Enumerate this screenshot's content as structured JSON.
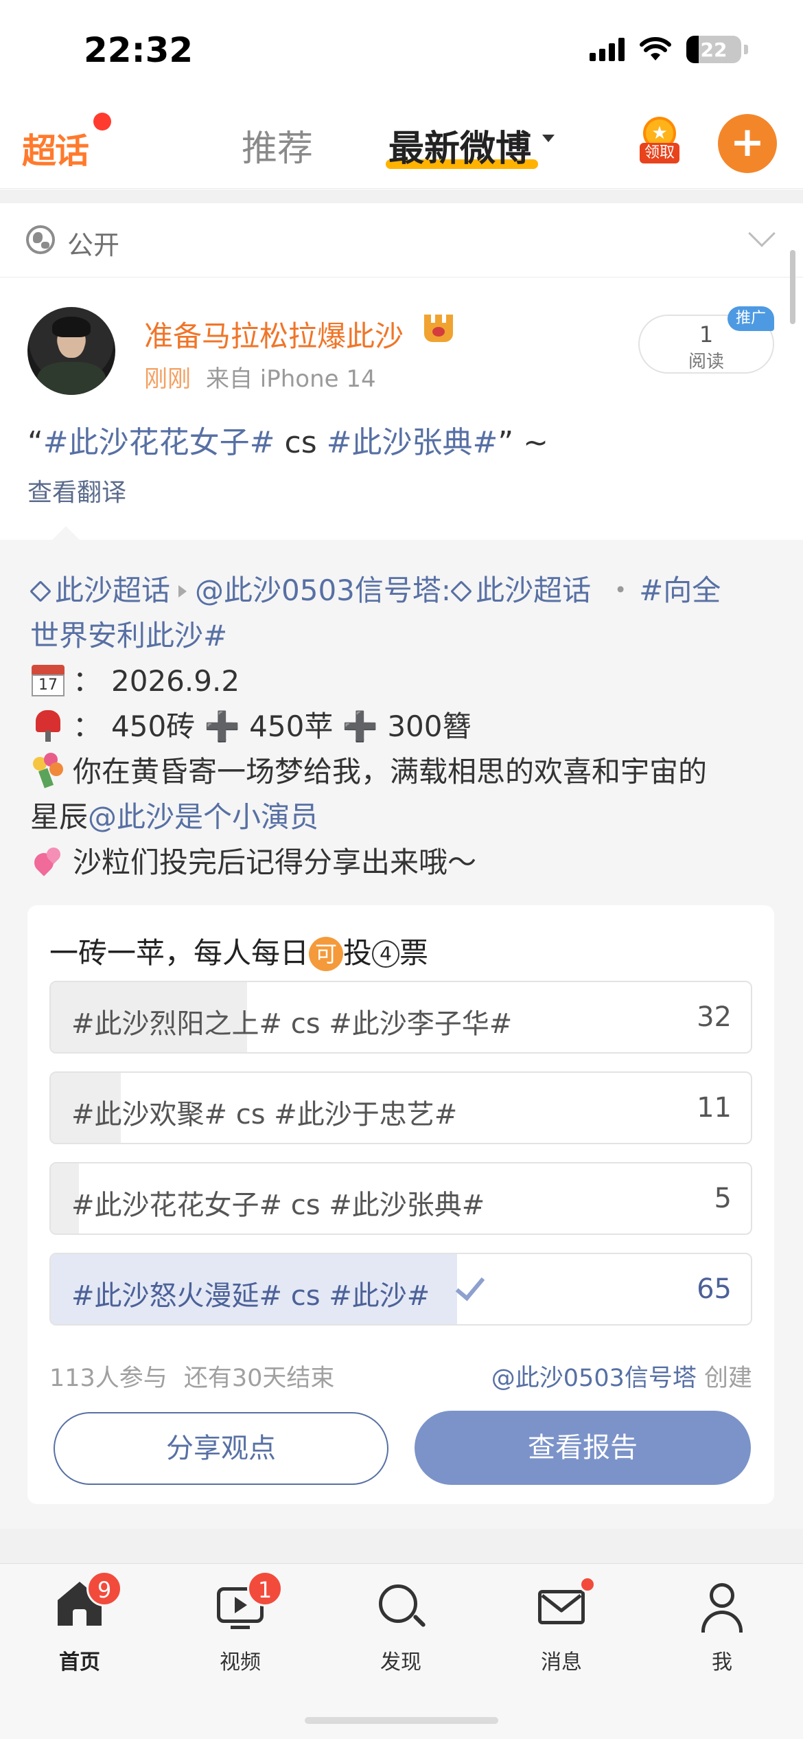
{
  "status_bar": {
    "time": "22:32",
    "battery": "22",
    "battery_level": 0.22
  },
  "header": {
    "logo": "超话",
    "tabs": [
      {
        "label": "推荐"
      },
      {
        "label": "最新微博"
      }
    ],
    "reward_label": "领取",
    "plus_label": "+"
  },
  "visibility": {
    "label": "公开"
  },
  "post": {
    "author": "准备马拉松拉爆此沙",
    "time": "刚刚",
    "source": "来自 iPhone 14",
    "read_count": "1",
    "read_label": "阅读",
    "promo_badge": "推广",
    "text_open": "“",
    "text_tag1": "#此沙花花女子#",
    "text_cs": " cs ",
    "text_tag2": "#此沙张典#",
    "text_close": "” ~",
    "translate": "查看翻译"
  },
  "repost": {
    "supertopic": "此沙超话",
    "mention": "@此沙0503信号塔:",
    "supertopic2": "此沙超话",
    "dot": "・",
    "hashtag_part1": "#向全",
    "hashtag_part2": "世界安利此沙#",
    "cal_day": "17",
    "date_sep": "：",
    "date": "2026.9.2",
    "mail_sep": "：",
    "requirement": "450砖 ➕ 450苹 ➕ 300簪",
    "message_line1": "你在黄昏寄一场梦给我，满载相思的欢喜和宇宙的",
    "message_line2_prefix": "星辰",
    "message_mention": "@此沙是个小演员",
    "reminder": "沙粒们投完后记得分享出来哦～"
  },
  "poll": {
    "title_prefix": "一砖一苹，每人每日",
    "title_badge": "可",
    "title_mid": "投",
    "title_circle": "4",
    "title_suffix": "票",
    "options": [
      {
        "label": "#此沙烈阳之上# cs #此沙李子华#",
        "count": "32",
        "fraction": 0.28,
        "selected": false
      },
      {
        "label": "#此沙欢聚# cs #此沙于忠艺#",
        "count": "11",
        "fraction": 0.1,
        "selected": false
      },
      {
        "label": "#此沙花花女子# cs #此沙张典#",
        "count": "5",
        "fraction": 0.04,
        "selected": false
      },
      {
        "label": "#此沙怒火漫延# cs #此沙#",
        "count": "65",
        "fraction": 0.58,
        "selected": true
      }
    ],
    "participants": "113人参与",
    "remaining": "还有30天结束",
    "creator": "@此沙0503信号塔",
    "creator_suffix": " 创建",
    "share_button": "分享观点",
    "report_button": "查看报告"
  },
  "tabbar": {
    "items": [
      {
        "label": "首页",
        "badge": "9"
      },
      {
        "label": "视频",
        "badge": "1"
      },
      {
        "label": "发现"
      },
      {
        "label": "消息"
      },
      {
        "label": "我"
      }
    ]
  },
  "colors": {
    "accent": "#f4862a",
    "link": "#5770a4",
    "report_button": "#7b93c9",
    "badge": "#f24b3c"
  }
}
